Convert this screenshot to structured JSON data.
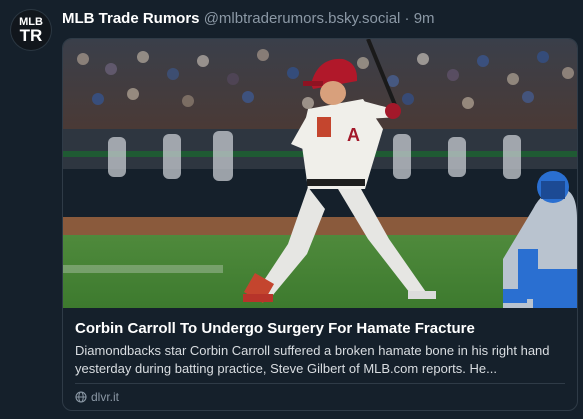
{
  "post": {
    "avatar_text_top": "MLB",
    "avatar_text_bottom": "TR",
    "author_name": "MLB Trade Rumors",
    "handle": "@mlbtraderumors.bsky.social",
    "separator": "·",
    "time": "9m"
  },
  "card": {
    "title": "Corbin Carroll To Undergo Surgery For Hamate Fracture",
    "description": "Diamondbacks star Corbin Carroll suffered a broken hamate bone in his right hand yesterday during batting practice, Steve Gilbert of MLB.com reports. He...",
    "source": "dlvr.it",
    "source_icon": "globe-icon",
    "image_alt": "Baseball player in white uniform and red helmet batting, catcher in blue gear behind him"
  },
  "colors": {
    "background": "#15202b",
    "border": "#2f3b47",
    "muted_text": "#8b98a5",
    "helmet_red": "#b1182a",
    "catcher_blue": "#2a6fd1"
  }
}
